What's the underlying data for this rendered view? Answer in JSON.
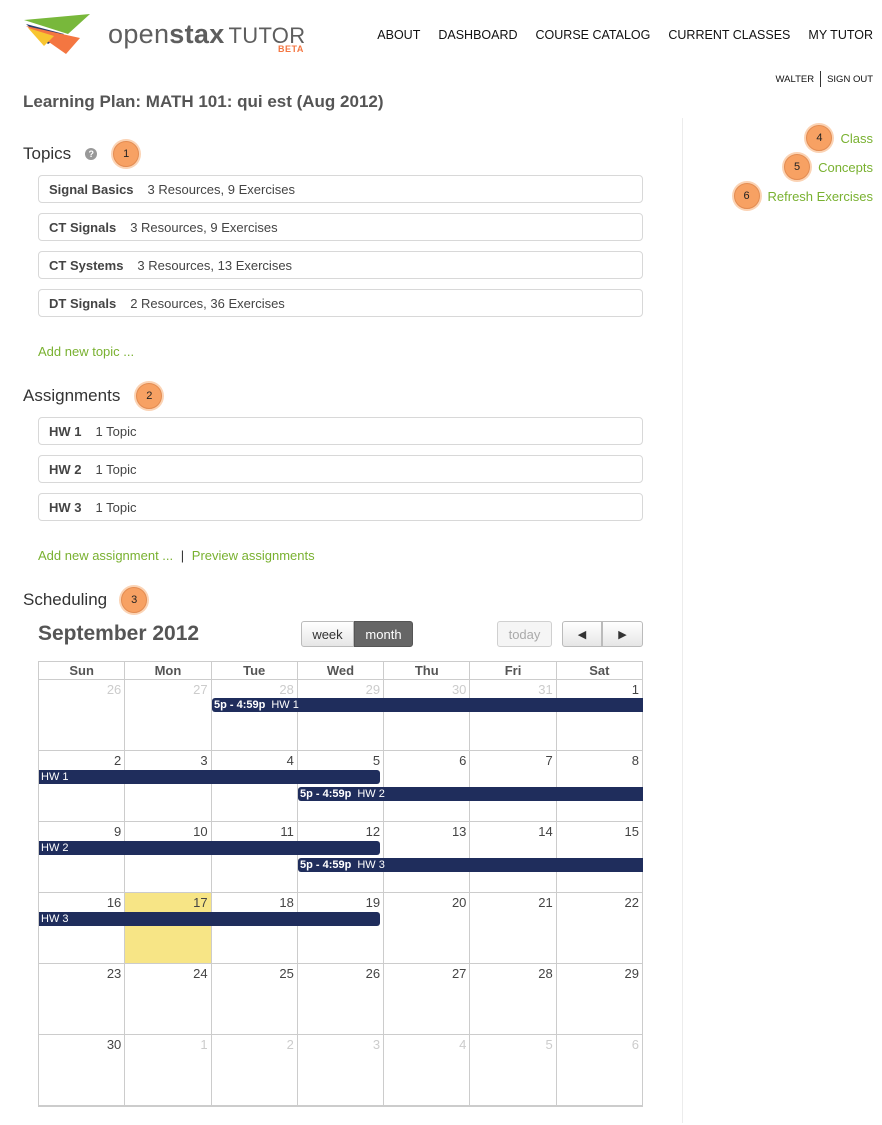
{
  "header": {
    "logo_open": "open",
    "logo_stax": "stax",
    "logo_tutor": "TUTOR",
    "logo_beta": "BETA",
    "nav": [
      "ABOUT",
      "DASHBOARD",
      "COURSE CATALOG",
      "CURRENT CLASSES",
      "MY TUTOR"
    ],
    "user": "WALTER",
    "signout": "SIGN OUT"
  },
  "page_title": "Learning Plan: MATH 101: qui est (Aug 2012)",
  "sidebar": {
    "links": [
      {
        "badge": "4",
        "label": "Class"
      },
      {
        "badge": "5",
        "label": "Concepts"
      },
      {
        "badge": "6",
        "label": "Refresh Exercises"
      }
    ]
  },
  "topics": {
    "heading": "Topics",
    "help_icon": "?",
    "badge": "1",
    "items": [
      {
        "name": "Signal Basics",
        "meta": "3 Resources, 9 Exercises"
      },
      {
        "name": "CT Signals",
        "meta": "3 Resources, 9 Exercises"
      },
      {
        "name": "CT Systems",
        "meta": "3 Resources, 13 Exercises"
      },
      {
        "name": "DT Signals",
        "meta": "2 Resources, 36 Exercises"
      }
    ],
    "add_link": "Add new topic ..."
  },
  "assignments": {
    "heading": "Assignments",
    "badge": "2",
    "items": [
      {
        "name": "HW 1",
        "meta": "1 Topic"
      },
      {
        "name": "HW 2",
        "meta": "1 Topic"
      },
      {
        "name": "HW 3",
        "meta": "1 Topic"
      }
    ],
    "add_link": "Add new assignment ...",
    "separator": "|",
    "preview_link": "Preview assignments"
  },
  "scheduling": {
    "heading": "Scheduling",
    "badge": "3",
    "month_title": "September 2012",
    "view_week": "week",
    "view_month": "month",
    "today_btn": "today",
    "prev_btn": "◀",
    "next_btn": "▶",
    "weekdays": [
      "Sun",
      "Mon",
      "Tue",
      "Wed",
      "Thu",
      "Fri",
      "Sat"
    ],
    "weeks": [
      [
        "26",
        "27",
        "28",
        "29",
        "30",
        "31",
        "1"
      ],
      [
        "2",
        "3",
        "4",
        "5",
        "6",
        "7",
        "8"
      ],
      [
        "9",
        "10",
        "11",
        "12",
        "13",
        "14",
        "15"
      ],
      [
        "16",
        "17",
        "18",
        "19",
        "20",
        "21",
        "22"
      ],
      [
        "23",
        "24",
        "25",
        "26",
        "27",
        "28",
        "29"
      ],
      [
        "30",
        "1",
        "2",
        "3",
        "4",
        "5",
        "6"
      ]
    ],
    "events": [
      {
        "time": "5p - 4:59p",
        "title": "HW 1"
      },
      {
        "time": "",
        "title": "HW 1"
      },
      {
        "time": "5p - 4:59p",
        "title": "HW 2"
      },
      {
        "time": "",
        "title": "HW 2"
      },
      {
        "time": "5p - 4:59p",
        "title": "HW 3"
      },
      {
        "time": "",
        "title": "HW 3"
      }
    ]
  },
  "colors": {
    "accent_green": "#79b130",
    "badge_orange": "#f7a163",
    "event_navy": "#1f2d5c",
    "today_yellow": "#f7e586"
  }
}
